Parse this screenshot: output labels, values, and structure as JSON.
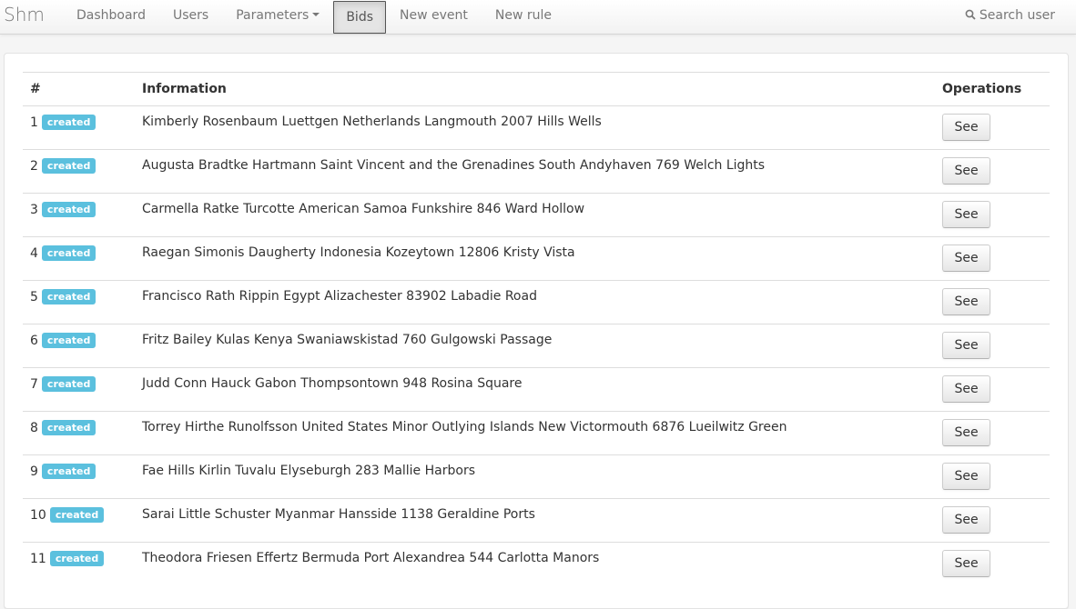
{
  "navbar": {
    "brand": "Shm",
    "items": [
      {
        "label": "Dashboard"
      },
      {
        "label": "Users"
      },
      {
        "label": "Parameters"
      },
      {
        "label": "Bids"
      },
      {
        "label": "New event"
      },
      {
        "label": "New rule"
      }
    ],
    "search_label": "Search user"
  },
  "table": {
    "headers": {
      "num": "#",
      "info": "Information",
      "ops": "Operations"
    },
    "rows": [
      {
        "num": "1",
        "status": "created",
        "info": "Kimberly Rosenbaum Luettgen Netherlands Langmouth 2007 Hills Wells",
        "action": "See"
      },
      {
        "num": "2",
        "status": "created",
        "info": "Augusta Bradtke Hartmann Saint Vincent and the Grenadines South Andyhaven 769 Welch Lights",
        "action": "See"
      },
      {
        "num": "3",
        "status": "created",
        "info": "Carmella Ratke Turcotte American Samoa Funkshire 846 Ward Hollow",
        "action": "See"
      },
      {
        "num": "4",
        "status": "created",
        "info": "Raegan Simonis Daugherty Indonesia Kozeytown 12806 Kristy Vista",
        "action": "See"
      },
      {
        "num": "5",
        "status": "created",
        "info": "Francisco Rath Rippin Egypt Alizachester 83902 Labadie Road",
        "action": "See"
      },
      {
        "num": "6",
        "status": "created",
        "info": "Fritz Bailey Kulas Kenya Swaniawskistad 760 Gulgowski Passage",
        "action": "See"
      },
      {
        "num": "7",
        "status": "created",
        "info": "Judd Conn Hauck Gabon Thompsontown 948 Rosina Square",
        "action": "See"
      },
      {
        "num": "8",
        "status": "created",
        "info": "Torrey Hirthe Runolfsson United States Minor Outlying Islands New Victormouth 6876 Lueilwitz Green",
        "action": "See"
      },
      {
        "num": "9",
        "status": "created",
        "info": "Fae Hills Kirlin Tuvalu Elyseburgh 283 Mallie Harbors",
        "action": "See"
      },
      {
        "num": "10",
        "status": "created",
        "info": "Sarai Little Schuster Myanmar Hansside 1138 Geraldine Ports",
        "action": "See"
      },
      {
        "num": "11",
        "status": "created",
        "info": "Theodora Friesen Effertz Bermuda Port Alexandrea 544 Carlotta Manors",
        "action": "See"
      }
    ]
  }
}
